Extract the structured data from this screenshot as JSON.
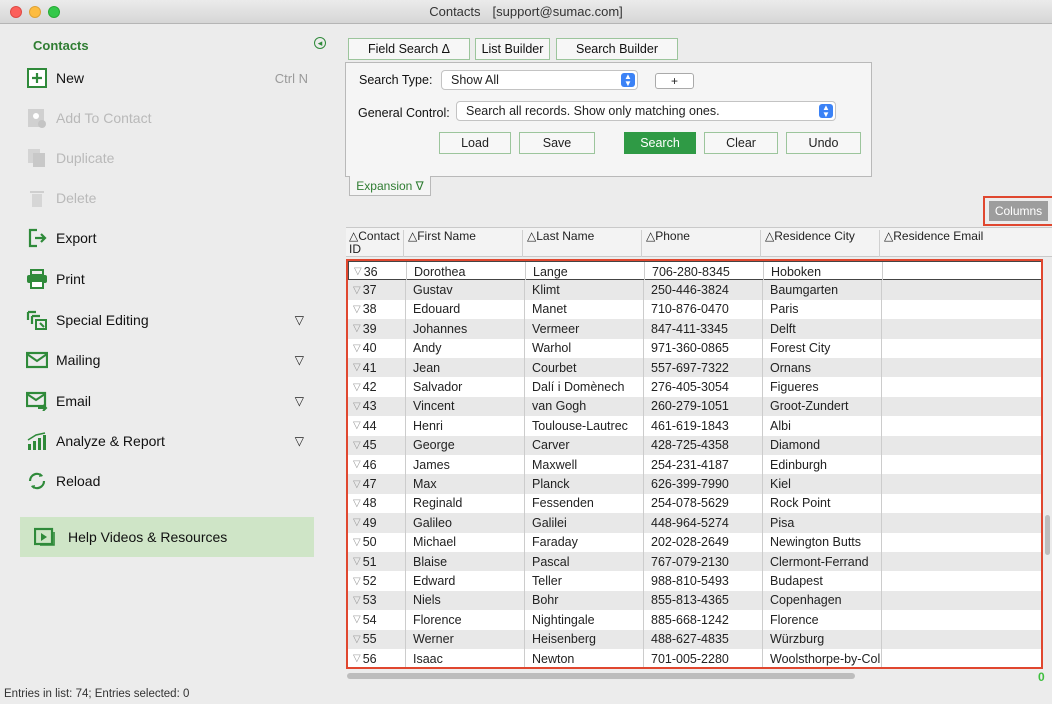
{
  "window": {
    "title": "Contacts",
    "account": "[support@sumac.com]"
  },
  "sidebar": {
    "title": "Contacts",
    "items": [
      {
        "label": "New",
        "shortcut": "Ctrl N",
        "icon": "plus-box-icon"
      },
      {
        "label": "Add To Contact",
        "icon": "add-contact-icon"
      },
      {
        "label": "Duplicate",
        "icon": "duplicate-icon"
      },
      {
        "label": "Delete",
        "icon": "trash-icon"
      },
      {
        "label": "Export",
        "icon": "export-icon"
      },
      {
        "label": "Print",
        "icon": "printer-icon"
      },
      {
        "label": "Special Editing",
        "submenu": "▽",
        "icon": "special-editing-icon"
      },
      {
        "label": "Mailing",
        "submenu": "▽",
        "icon": "mail-icon"
      },
      {
        "label": "Email",
        "submenu": "▽",
        "icon": "email-icon"
      },
      {
        "label": "Analyze & Report",
        "submenu": "▽",
        "icon": "bar-chart-icon"
      },
      {
        "label": "Reload",
        "icon": "reload-icon"
      }
    ],
    "help": {
      "label": "Help Videos & Resources",
      "icon": "video-icon"
    }
  },
  "toolbar": {
    "field_search": "Field Search Δ",
    "list_builder": "List Builder",
    "search_builder": "Search Builder"
  },
  "search": {
    "type_label": "Search Type:",
    "type_value": "Show All",
    "plus": "+",
    "control_label": "General Control:",
    "control_value": "Search all records. Show only matching ones.",
    "load": "Load",
    "save": "Save",
    "search": "Search",
    "clear": "Clear",
    "undo": "Undo",
    "expansion": "Expansion ∇"
  },
  "columns_button": "Columns",
  "table": {
    "headers": [
      "△Contact ID",
      "△First Name",
      "△Last Name",
      "△Phone",
      "△Residence City",
      "△Residence Email"
    ],
    "rows": [
      [
        "36",
        "Dorothea",
        "Lange",
        "706-280-8345",
        "Hoboken"
      ],
      [
        "37",
        "Gustav",
        "Klimt",
        "250-446-3824",
        "Baumgarten"
      ],
      [
        "38",
        "Edouard",
        "Manet",
        "710-876-0470",
        "Paris"
      ],
      [
        "39",
        "Johannes",
        "Vermeer",
        "847-411-3345",
        "Delft"
      ],
      [
        "40",
        "Andy",
        "Warhol",
        "971-360-0865",
        "Forest City"
      ],
      [
        "41",
        "Jean",
        "Courbet",
        "557-697-7322",
        "Ornans"
      ],
      [
        "42",
        "Salvador",
        "Dalí i Domènech",
        "276-405-3054",
        "Figueres"
      ],
      [
        "43",
        "Vincent",
        "van Gogh",
        "260-279-1051",
        "Groot-Zundert"
      ],
      [
        "44",
        "Henri",
        "Toulouse-Lautrec",
        "461-619-1843",
        "Albi"
      ],
      [
        "45",
        "George",
        "Carver",
        "428-725-4358",
        "Diamond"
      ],
      [
        "46",
        "James",
        "Maxwell",
        "254-231-4187",
        "Edinburgh"
      ],
      [
        "47",
        "Max",
        "Planck",
        "626-399-7990",
        "Kiel"
      ],
      [
        "48",
        "Reginald",
        "Fessenden",
        "254-078-5629",
        "Rock Point"
      ],
      [
        "49",
        "Galileo",
        "Galilei",
        "448-964-5274",
        "Pisa"
      ],
      [
        "50",
        "Michael",
        "Faraday",
        "202-028-2649",
        "Newington Butts"
      ],
      [
        "51",
        "Blaise",
        "Pascal",
        "767-079-2130",
        "Clermont-Ferrand"
      ],
      [
        "52",
        "Edward",
        "Teller",
        "988-810-5493",
        "Budapest"
      ],
      [
        "53",
        "Niels",
        "Bohr",
        "855-813-4365",
        "Copenhagen"
      ],
      [
        "54",
        "Florence",
        "Nightingale",
        "885-668-1242",
        "Florence"
      ],
      [
        "55",
        "Werner",
        "Heisenberg",
        "488-627-4835",
        "Würzburg"
      ],
      [
        "56",
        "Isaac",
        "Newton",
        "701-005-2280",
        "Woolsthorpe-by-Col"
      ]
    ]
  },
  "corner_count": "0",
  "status": "Entries in list: 74; Entries selected: 0",
  "colors": {
    "accent_green": "#2f9a45",
    "highlight_red": "#e0472f"
  }
}
